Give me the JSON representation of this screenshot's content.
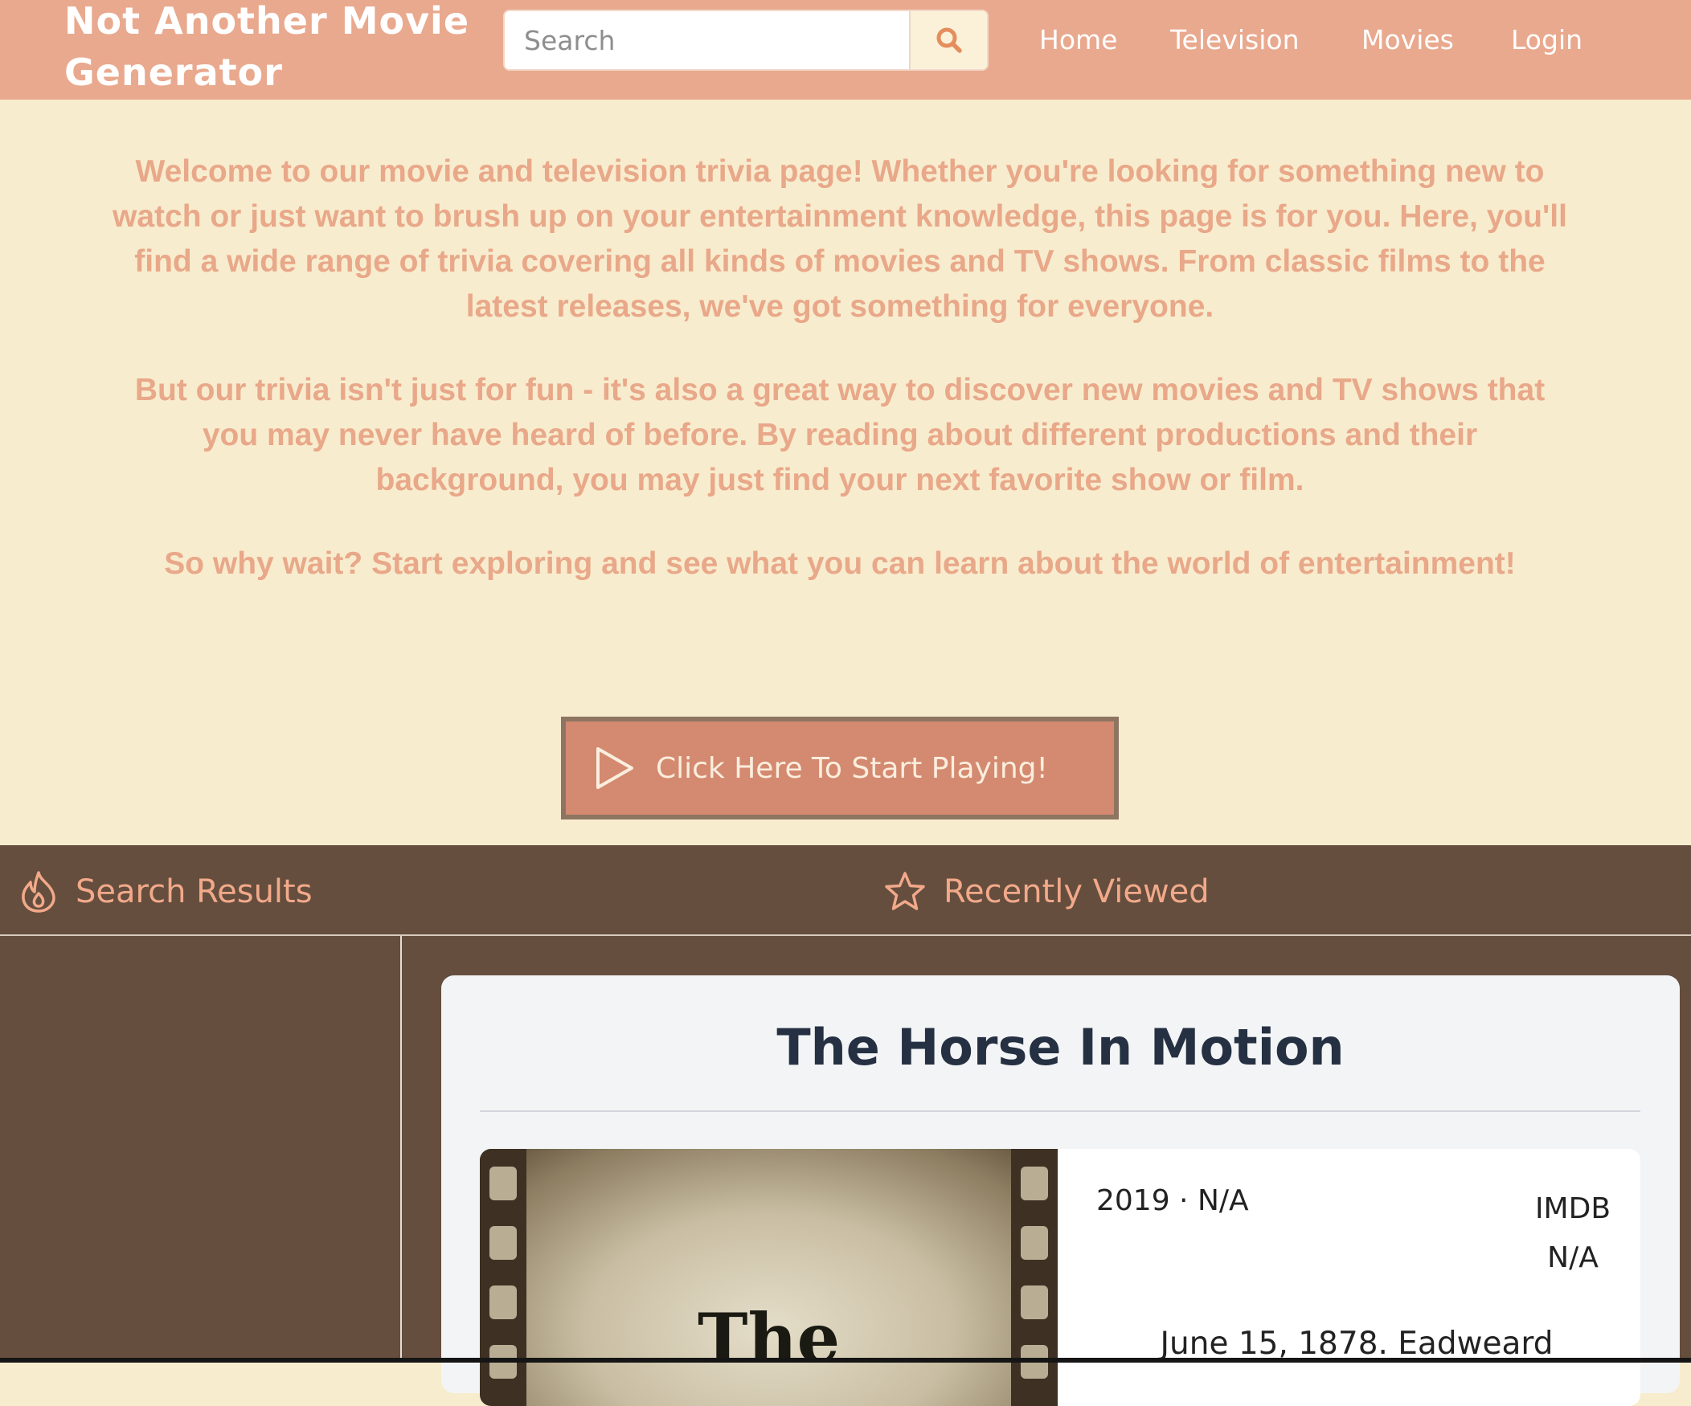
{
  "header": {
    "logo_line1": "Not Another Movie",
    "logo_line2": "Generator",
    "search": {
      "placeholder": "Search",
      "value": ""
    },
    "nav": [
      {
        "label": "Home"
      },
      {
        "label": "Television"
      },
      {
        "label": "Movies"
      },
      {
        "label": "Login"
      }
    ]
  },
  "intro": {
    "paragraphs": [
      "Welcome to our movie and television trivia page! Whether you're looking for something new to watch or just want to brush up on your entertainment knowledge, this page is for you. Here, you'll find a wide range of trivia covering all kinds of movies and TV shows. From classic films to the latest releases, we've got something for everyone.",
      "But our trivia isn't just for fun - it's also a great way to discover new movies and TV shows that you may never have heard of before. By reading about different productions and their background, you may just find your next favorite show or film.",
      "So why wait? Start exploring and see what you can learn about the world of entertainment!"
    ],
    "play_button": "Click Here To Start Playing!"
  },
  "tabs": [
    {
      "label": "Search Results",
      "icon": "flame-icon"
    },
    {
      "label": "Recently Viewed",
      "icon": "star-icon"
    }
  ],
  "card": {
    "title": "The Horse In Motion",
    "poster_text": "The",
    "meta": "2019 · N/A",
    "imdb_label": "IMDB",
    "imdb_value": "N/A",
    "plot": "June 15, 1878. Eadweard"
  },
  "colors": {
    "header_bg": "#e9a98e",
    "page_bg": "#f8ecce",
    "intro_text": "#e8a889",
    "button_bg": "#d48a70",
    "lower_bg": "#654e3e",
    "tab_text": "#f2a98a",
    "card_title": "#253142"
  }
}
